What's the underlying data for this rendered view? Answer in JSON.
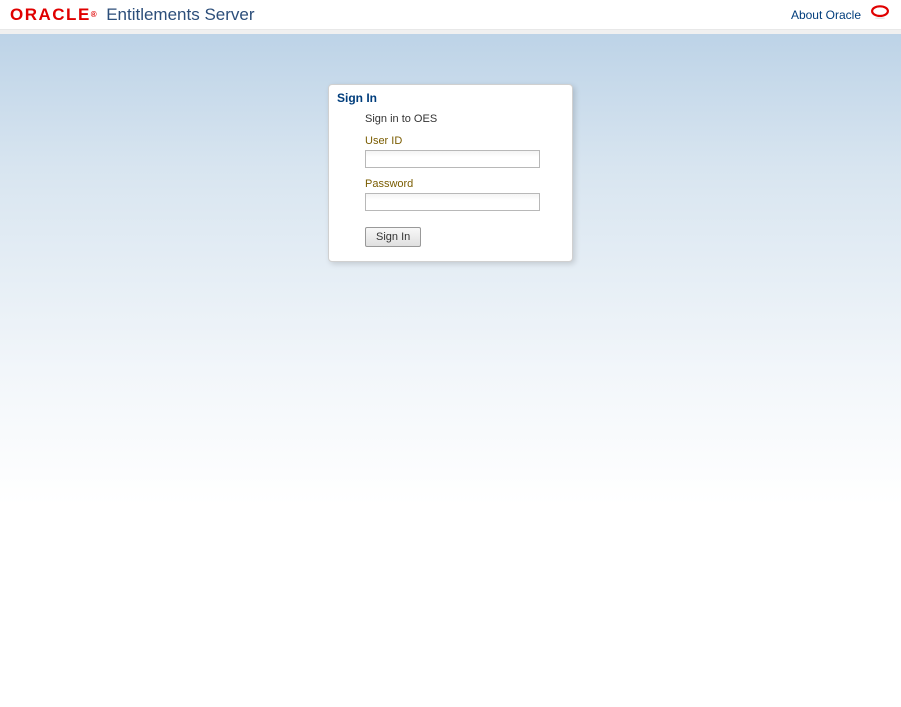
{
  "header": {
    "logo_text": "ORACLE",
    "logo_trademark": "®",
    "app_title": "Entitlements Server",
    "about_link": "About Oracle"
  },
  "signin": {
    "title": "Sign In",
    "subtitle": "Sign in to OES",
    "user_id_label": "User ID",
    "user_id_value": "",
    "password_label": "Password",
    "password_value": "",
    "button_label": "Sign In"
  }
}
